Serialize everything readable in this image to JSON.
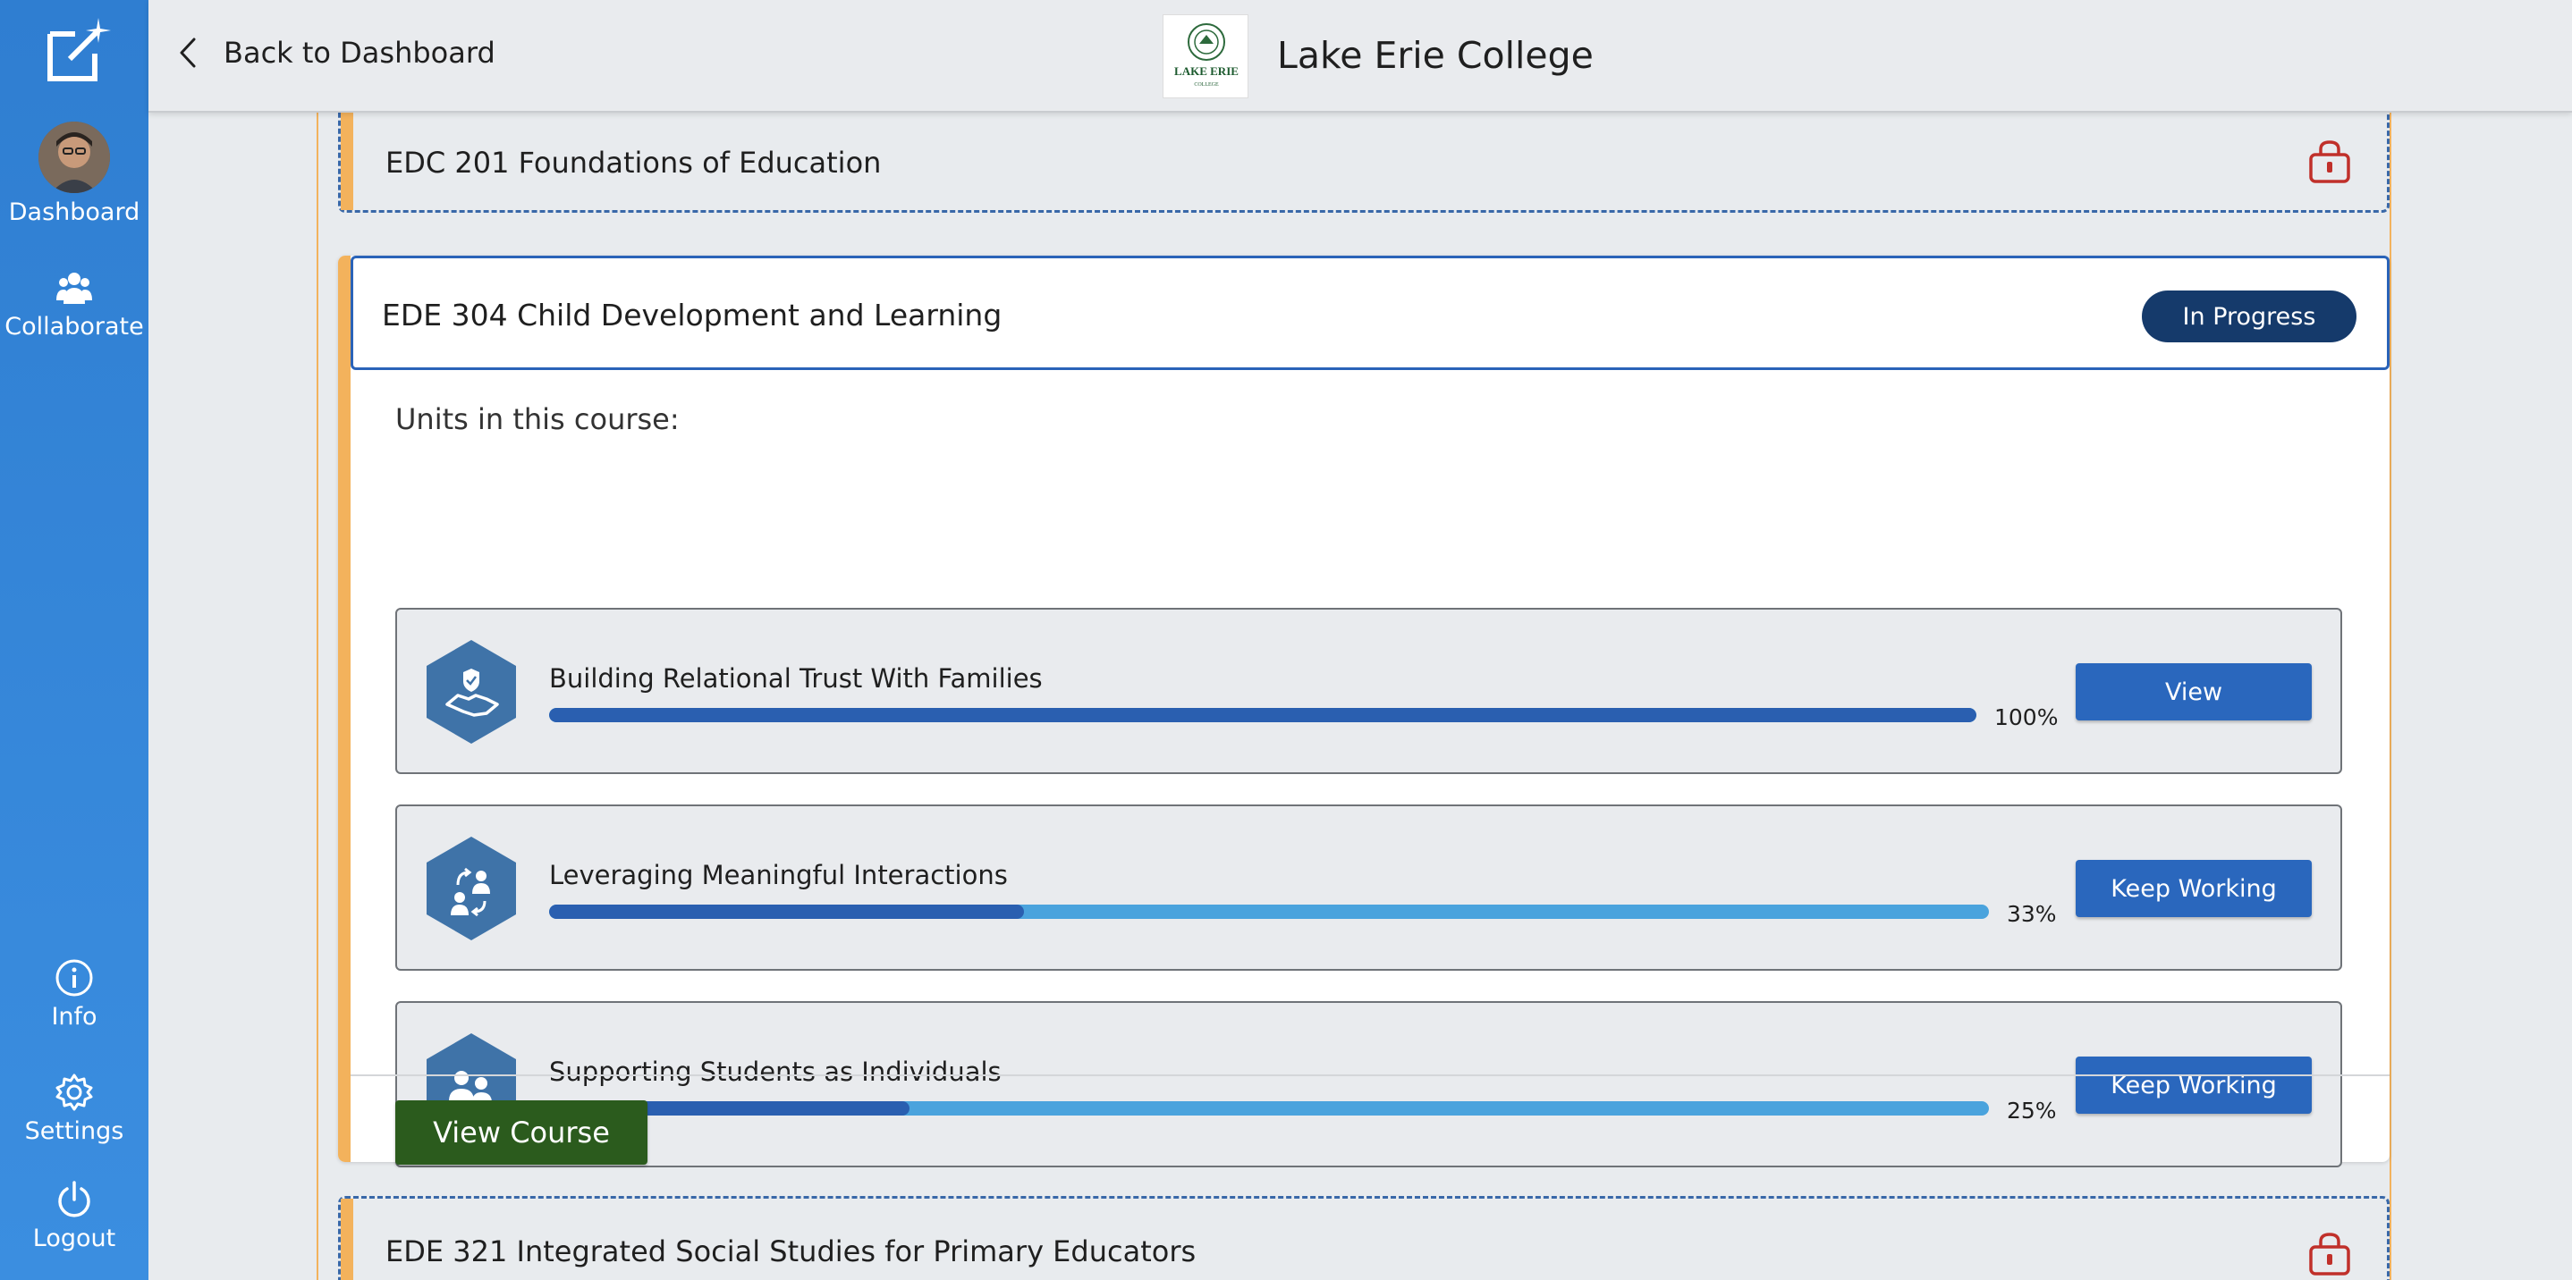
{
  "sidebar": {
    "items": [
      {
        "label": "Dashboard",
        "icon": "avatar"
      },
      {
        "label": "Collaborate",
        "icon": "people-icon"
      },
      {
        "label": "Info",
        "icon": "info-icon"
      },
      {
        "label": "Settings",
        "icon": "gear-icon"
      },
      {
        "label": "Logout",
        "icon": "power-icon"
      }
    ]
  },
  "header": {
    "back_label": "Back to Dashboard",
    "college_name": "Lake Erie College",
    "logo_text": "LAKE ERIE",
    "logo_subtext": "COLLEGE"
  },
  "courses": {
    "locked_top": {
      "title": "EDC 201 Foundations of Education"
    },
    "active": {
      "title": "EDE 304 Child Development and Learning",
      "status": "In Progress",
      "units_label": "Units in this course:",
      "units": [
        {
          "title": "Building Relational Trust With Families",
          "progress": 100,
          "progress_label": "100%",
          "button": "View",
          "icon": "handshake-shield-icon"
        },
        {
          "title": "Leveraging Meaningful Interactions",
          "progress": 33,
          "progress_label": "33%",
          "button": "Keep Working",
          "icon": "people-exchange-icon"
        },
        {
          "title": "Supporting Students as Individuals",
          "progress": 25,
          "progress_label": "25%",
          "button": "Keep Working",
          "icon": "two-people-icon"
        }
      ],
      "view_course_label": "View Course"
    },
    "locked_bottom": {
      "title": "EDE 321 Integrated Social Studies for Primary Educators"
    }
  },
  "colors": {
    "sidebar": "#3b8ee0",
    "accent_stripe": "#f3b25c",
    "status_badge": "#153a6b",
    "unit_button": "#2a67bd",
    "view_course_button": "#2b5b1d",
    "progress_fill": "#2a5fb0",
    "progress_track": "#4aa3dd",
    "lock_icon": "#c0302a"
  }
}
